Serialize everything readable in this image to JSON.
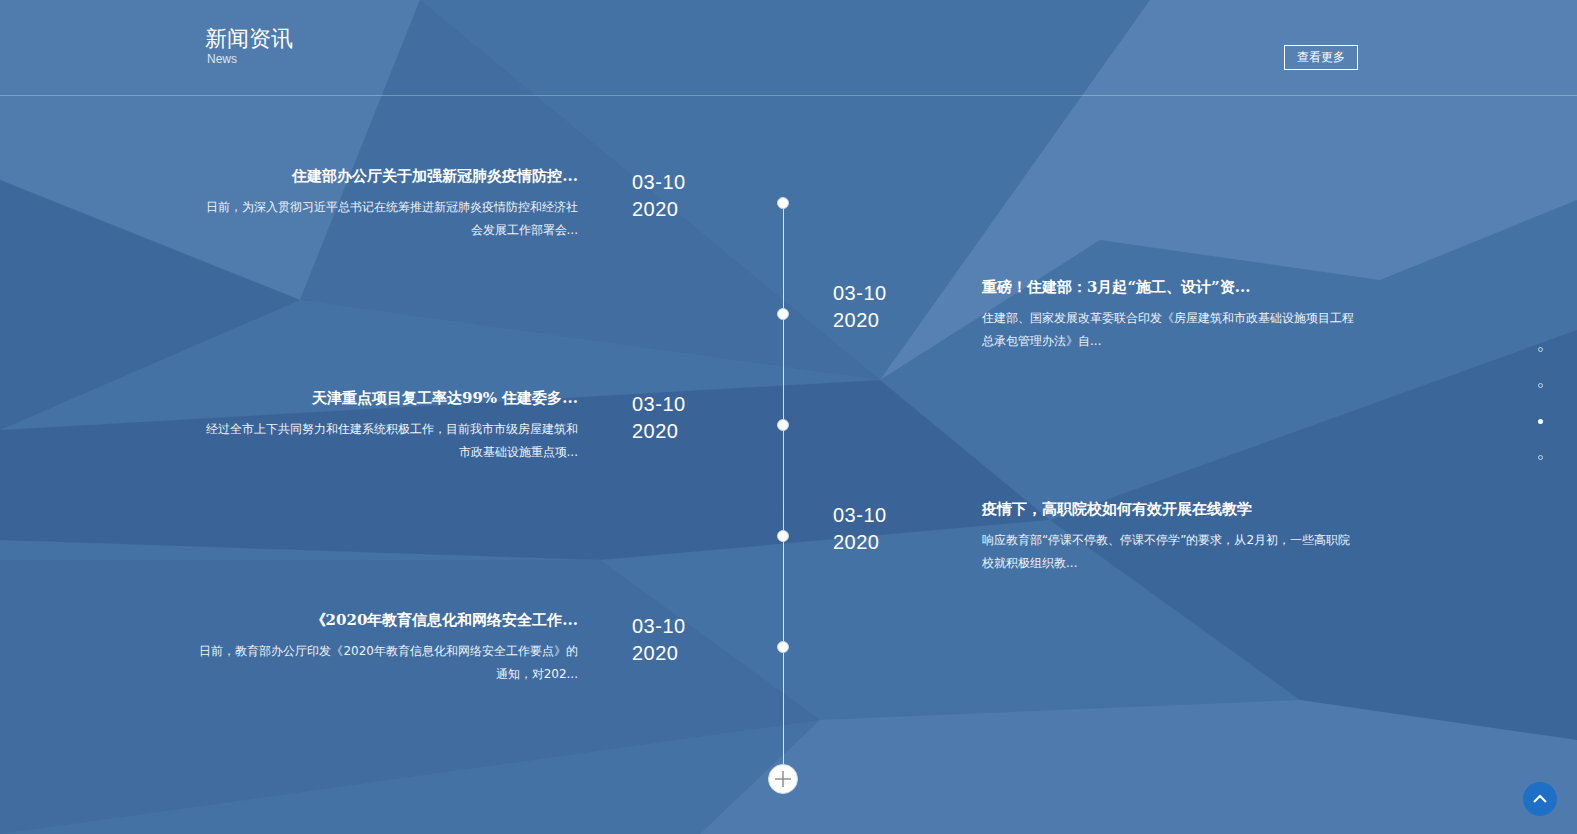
{
  "header": {
    "title": "新闻资讯",
    "subtitle": "News",
    "more_button": "查看更多"
  },
  "news": [
    {
      "kind": "left",
      "title": "住建部办公厅关于加强新冠肺炎疫情防控...",
      "desc": "日前，为深入贯彻习近平总书记在统筹推进新冠肺炎疫情防控和经济社会发展工作部署会...",
      "date": "03-10",
      "year": "2020"
    },
    {
      "kind": "right",
      "title": "重磅！住建部：3月起“施工、设计”资...",
      "desc": "住建部、国家发展改革委联合印发《房屋建筑和市政基础设施项目工程总承包管理办法》自...",
      "date": "03-10",
      "year": "2020"
    },
    {
      "kind": "left",
      "title": "天津重点项目复工率达99% 住建委多...",
      "desc": "经过全市上下共同努力和住建系统积极工作，目前我市市级房屋建筑和市政基础设施重点项...",
      "date": "03-10",
      "year": "2020"
    },
    {
      "kind": "right",
      "title": "疫情下，高职院校如何有效开展在线教学",
      "desc": "响应教育部“停课不停教、停课不停学”的要求，从2月初，一些高职院校就积极组织教...",
      "date": "03-10",
      "year": "2020"
    },
    {
      "kind": "left",
      "title": "《2020年教育信息化和网络安全工作...",
      "desc": "日前，教育部办公厅印发《2020年教育信息化和网络安全工作要点》的通知，对202...",
      "date": "03-10",
      "year": "2020"
    }
  ],
  "page_dots": [
    {
      "selected": false
    },
    {
      "selected": false
    },
    {
      "selected": true
    },
    {
      "selected": false
    }
  ]
}
